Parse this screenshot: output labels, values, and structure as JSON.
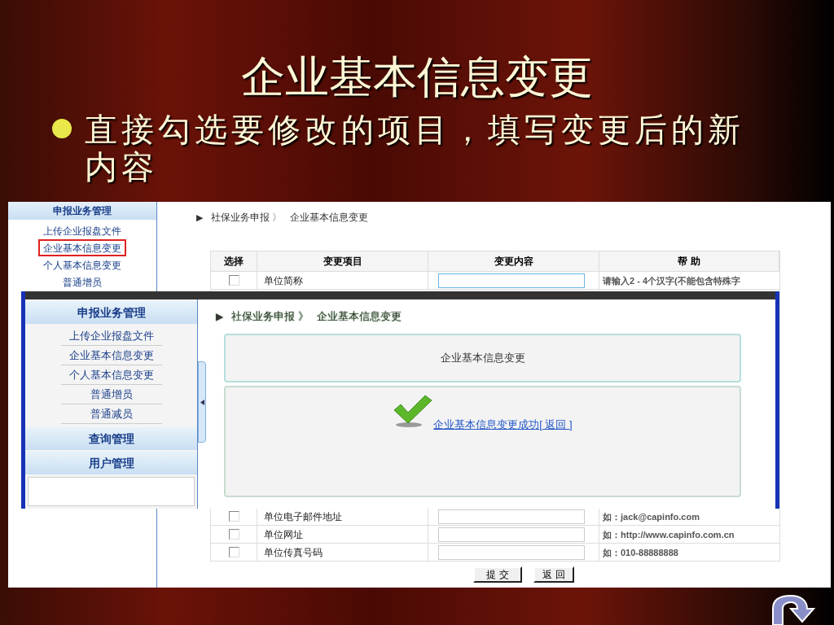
{
  "slide": {
    "title": "企业基本信息变更",
    "bullet": "直接勾选要修改的项目，填写变更后的新内容"
  },
  "back_screen": {
    "sidebar": {
      "header": "申报业务管理",
      "items": [
        {
          "label": "上传企业报盘文件",
          "selected": false
        },
        {
          "label": "企业基本信息变更",
          "selected": true
        },
        {
          "label": "个人基本信息变更",
          "selected": false
        },
        {
          "label": "普通增员",
          "selected": false
        }
      ]
    },
    "breadcrumb": [
      "▶",
      "社保业务申报 〉",
      "企业基本信息变更"
    ],
    "table": {
      "columns": [
        "选择",
        "变更项目",
        "变更内容",
        "帮 助"
      ],
      "top_rows": [
        {
          "checked": false,
          "item": "单位简称",
          "help": "请输入2 - 4个汉字(不能包含特殊字"
        }
      ],
      "bottom_rows": [
        {
          "checked": false,
          "item": "单位电子邮件地址",
          "help": "如：jack@capinfo.com"
        },
        {
          "checked": false,
          "item": "单位网址",
          "help": "如：http://www.capinfo.com.cn"
        },
        {
          "checked": false,
          "item": "单位传真号码",
          "help": "如：010-88888888"
        }
      ]
    },
    "buttons": [
      "提 交",
      "返 回"
    ]
  },
  "front_screen": {
    "sidebar": {
      "sections": [
        {
          "header": "申报业务管理",
          "items": [
            "上传企业报盘文件",
            "企业基本信息变更",
            "个人基本信息变更",
            "普通增员",
            "普通减员"
          ]
        },
        {
          "header": "查询管理"
        },
        {
          "header": "用户管理"
        }
      ]
    },
    "breadcrumb": [
      "▶",
      "社保业务申报 》",
      "企业基本信息变更"
    ],
    "panel_title": "企业基本信息变更",
    "message": "企业基本信息变更成功[ 返回 ]"
  }
}
